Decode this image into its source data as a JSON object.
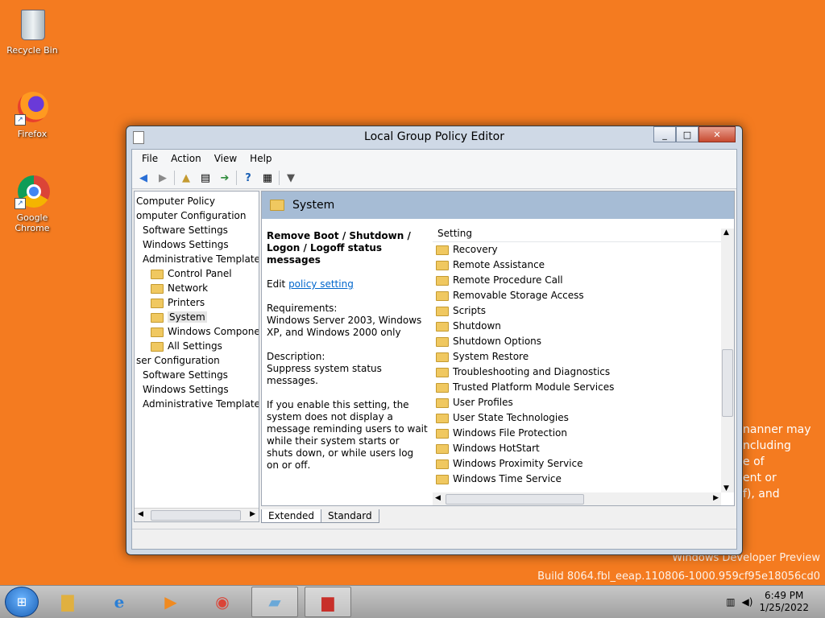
{
  "desktop": {
    "icons": [
      {
        "label": "Recycle Bin"
      },
      {
        "label": "Firefox"
      },
      {
        "label": "Google Chrome"
      }
    ],
    "watermark": {
      "line1": "Windows Developer Preview",
      "line2": "Build 8064.fbl_eeap.110806-1000.959cf95e18056cd0"
    },
    "bleed_text": [
      "nanner may",
      "ncluding",
      "e of",
      "ent or",
      "f), and"
    ]
  },
  "window": {
    "title": "Local Group Policy Editor",
    "menu": [
      "File",
      "Action",
      "View",
      "Help"
    ],
    "tree": [
      {
        "label": "Computer Policy",
        "indent": 0
      },
      {
        "label": "omputer Configuration",
        "indent": 0
      },
      {
        "label": "Software Settings",
        "indent": 1
      },
      {
        "label": "Windows Settings",
        "indent": 1
      },
      {
        "label": "Administrative Templates",
        "indent": 1
      },
      {
        "label": "Control Panel",
        "indent": 2
      },
      {
        "label": "Network",
        "indent": 2
      },
      {
        "label": "Printers",
        "indent": 2
      },
      {
        "label": "System",
        "indent": 2,
        "selected": true
      },
      {
        "label": "Windows Components",
        "indent": 2
      },
      {
        "label": "All Settings",
        "indent": 2
      },
      {
        "label": "ser Configuration",
        "indent": 0
      },
      {
        "label": "Software Settings",
        "indent": 1
      },
      {
        "label": "Windows Settings",
        "indent": 1
      },
      {
        "label": "Administrative Templates",
        "indent": 1
      }
    ],
    "header": "System",
    "description": {
      "title": "Remove Boot / Shutdown / Logon / Logoff status messages",
      "edit_prefix": "Edit ",
      "edit_link": "policy setting",
      "requirements_label": "Requirements:",
      "requirements": "Windows Server 2003, Windows XP, and Windows 2000 only",
      "description_label": "Description:",
      "description": "Suppress system status messages.",
      "details": "If you enable this setting, the system does not display a message reminding users to wait while their system starts or shuts down, or while users log on or off."
    },
    "list_header": "Setting",
    "list": [
      "Recovery",
      "Remote Assistance",
      "Remote Procedure Call",
      "Removable Storage Access",
      "Scripts",
      "Shutdown",
      "Shutdown Options",
      "System Restore",
      "Troubleshooting and Diagnostics",
      "Trusted Platform Module Services",
      "User Profiles",
      "User State Technologies",
      "Windows File Protection",
      "Windows HotStart",
      "Windows Proximity Service",
      "Windows Time Service"
    ],
    "tabs": [
      "Extended",
      "Standard"
    ]
  },
  "taskbar": {
    "time": "6:49 PM",
    "date": "1/25/2022"
  }
}
